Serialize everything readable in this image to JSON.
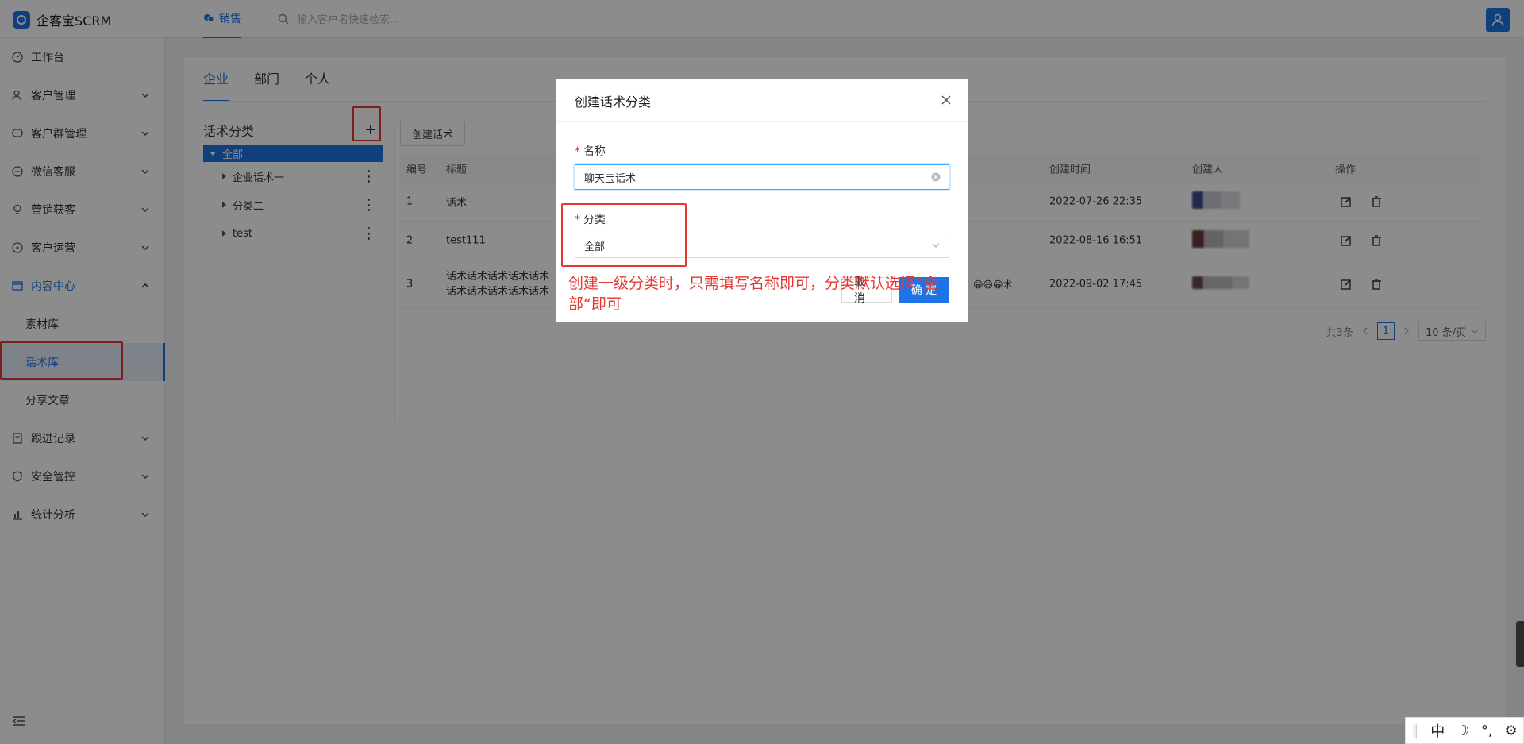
{
  "app": {
    "name": "企客宝SCRM"
  },
  "header": {
    "tab": "销售",
    "search_placeholder": "输入客户名快速检索..."
  },
  "sidebar": {
    "items": [
      {
        "label": "工作台"
      },
      {
        "label": "客户管理"
      },
      {
        "label": "客户群管理"
      },
      {
        "label": "微信客服"
      },
      {
        "label": "营销获客"
      },
      {
        "label": "客户运营"
      },
      {
        "label": "内容中心"
      },
      {
        "label": "素材库"
      },
      {
        "label": "话术库"
      },
      {
        "label": "分享文章"
      },
      {
        "label": "跟进记录"
      },
      {
        "label": "安全管控"
      },
      {
        "label": "统计分析"
      }
    ]
  },
  "content": {
    "tabs": [
      "企业",
      "部门",
      "个人"
    ],
    "category_title": "话术分类",
    "tree": [
      "全部",
      "企业话术一",
      "分类二",
      "test"
    ],
    "create_button": "创建话术",
    "table": {
      "headers": [
        "编号",
        "标题",
        "创建时间",
        "创建人",
        "操作"
      ],
      "rows": [
        {
          "id": "1",
          "title": "话术一",
          "title2": "",
          "time": "2022-07-26 22:35"
        },
        {
          "id": "2",
          "title": "test111",
          "title2": "",
          "time": "2022-08-16 16:51"
        },
        {
          "id": "3",
          "title": "话术话术话术话术话术",
          "title2": "话术话术话术话术话术",
          "tail": "😁😄😁术",
          "time": "2022-09-02 17:45"
        }
      ]
    },
    "pager": {
      "total": "共3条",
      "page": "1",
      "size": "10 条/页"
    }
  },
  "modal": {
    "title": "创建话术分类",
    "name_label": "名称",
    "name_value": "聊天宝话术",
    "category_label": "分类",
    "category_value": "全部",
    "cancel": "取 消",
    "ok": "确 定"
  },
  "annotation": {
    "text": "创建一级分类时，只需填写名称即可，分类默认选择”全部“即可"
  },
  "ime": {
    "lang": "中",
    "moon": "☽",
    "punct": "°,",
    "gear": "⚙"
  },
  "colors": {
    "primary": "#1e74e6",
    "annotation": "#e53935"
  }
}
